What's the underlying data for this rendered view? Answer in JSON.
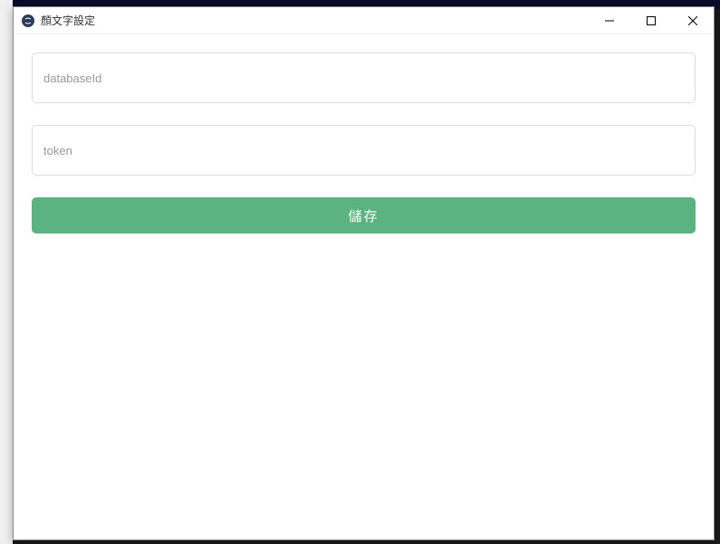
{
  "window": {
    "title": "顏文字設定"
  },
  "form": {
    "databaseId": {
      "placeholder": "databaseId",
      "value": ""
    },
    "token": {
      "placeholder": "token",
      "value": ""
    },
    "save_label": "儲存"
  },
  "colors": {
    "accent": "#5bb381"
  }
}
